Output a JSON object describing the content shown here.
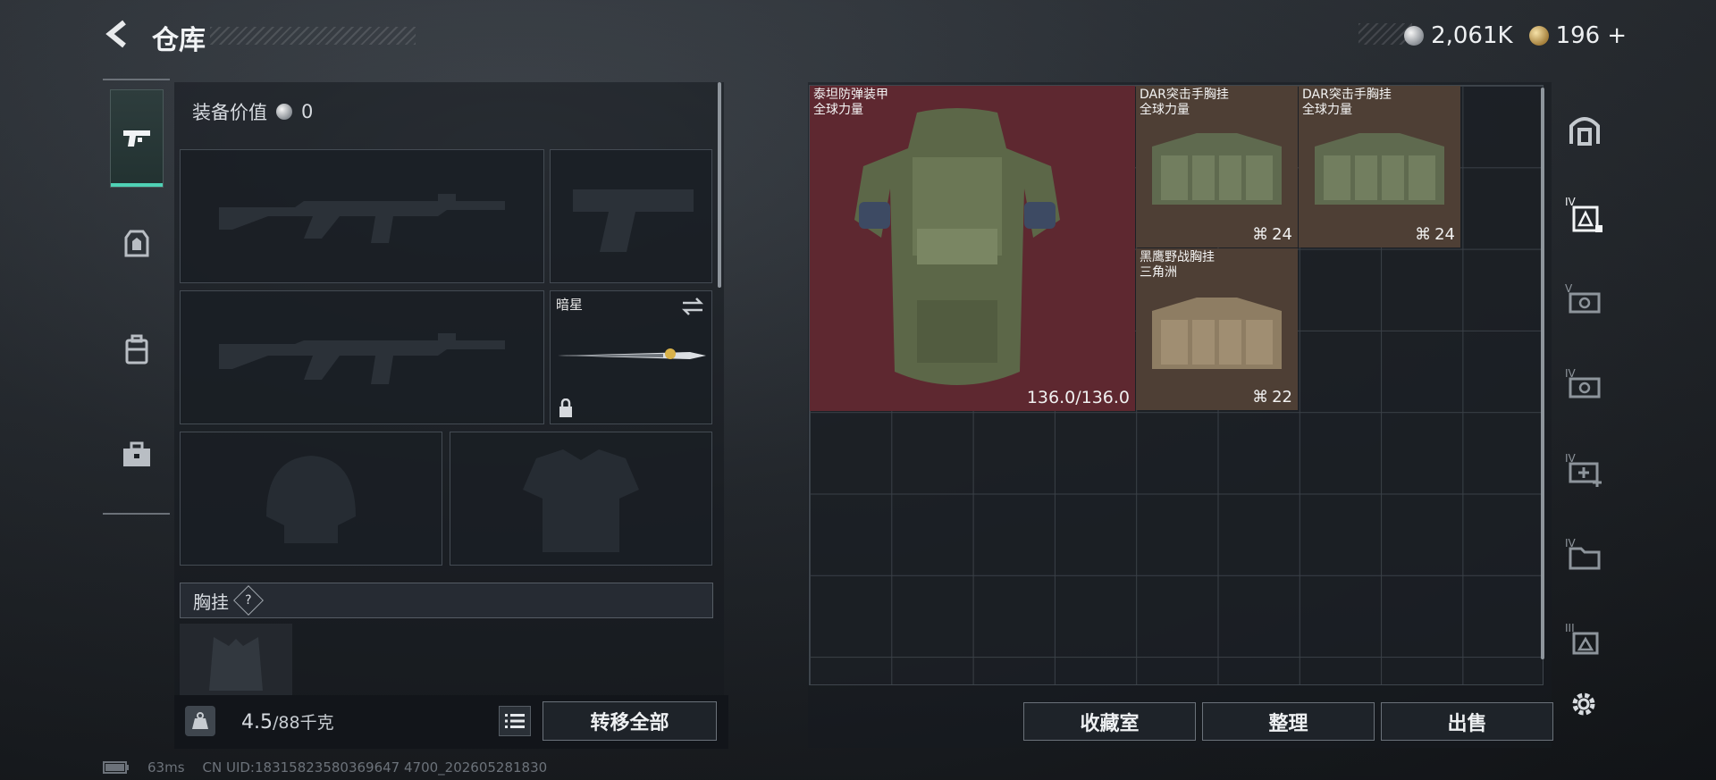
{
  "header": {
    "title": "仓库",
    "currencies": [
      {
        "icon": "silver-coin-icon",
        "value": "2,061K"
      },
      {
        "icon": "gold-coin-icon",
        "value": "196"
      }
    ],
    "add_label": "+"
  },
  "left_tabs": [
    {
      "icon": "pistol-icon",
      "active": true
    },
    {
      "icon": "armor-plate-icon",
      "active": false
    },
    {
      "icon": "backpack-icon",
      "active": false
    },
    {
      "icon": "toolbox-icon",
      "active": false
    }
  ],
  "loadout": {
    "equipment_value_label": "装备价值",
    "equipment_value": "0",
    "melee_slot_label": "暗星",
    "section_title": "胸挂",
    "section_help": "?",
    "weight_value": "4.5",
    "weight_max": "/88千克",
    "transfer_all_label": "转移全部"
  },
  "storage": {
    "items": [
      {
        "name": "泰坦防弹装甲",
        "subtitle": "全球力量",
        "durability": "136.0/136.0",
        "type": "armor"
      },
      {
        "name": "DAR突击手胸挂",
        "subtitle": "全球力量",
        "count": "24",
        "type": "rig"
      },
      {
        "name": "DAR突击手胸挂",
        "subtitle": "全球力量",
        "count": "24",
        "type": "rig"
      },
      {
        "name": "黑鹰野战胸挂",
        "subtitle": "三角洲",
        "count": "22",
        "type": "rig"
      }
    ],
    "buttons": {
      "collection": "收藏室",
      "organize": "整理",
      "sell": "出售"
    }
  },
  "right_tabs": [
    {
      "icon": "vault-icon"
    },
    {
      "icon": "armor-tier-iv-icon"
    },
    {
      "icon": "camera-tier-v-icon"
    },
    {
      "icon": "camera-tier-iv-icon"
    },
    {
      "icon": "medkit-tier-iv-icon"
    },
    {
      "icon": "folder-tier-iv-icon"
    },
    {
      "icon": "armor-tier-iii-icon"
    }
  ],
  "status": {
    "latency": "63ms",
    "uid": "CN UID:18315823580369647 4700_202605281830"
  },
  "colors": {
    "accent": "#4fd1b5",
    "armor_bg": "#5e2830",
    "rig_bg": "#4e3f35"
  }
}
